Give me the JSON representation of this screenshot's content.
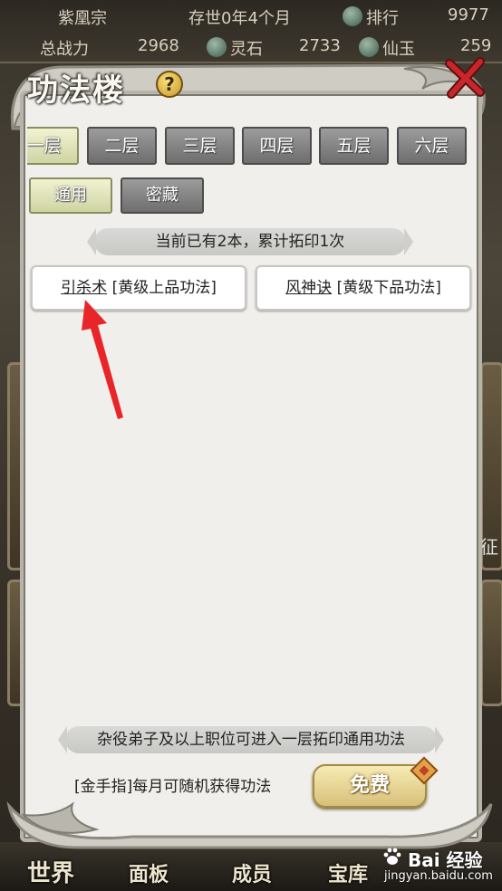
{
  "top_bar": {
    "sect_name": "紫凰宗",
    "era": "存世0年4个月",
    "rank_label": "排行",
    "rank_value": "9977",
    "power_label": "总战力",
    "power_value": "2968",
    "spirit_stone_label": "灵石",
    "spirit_stone_value": "2733",
    "jade_label": "仙玉",
    "jade_value": "259"
  },
  "dialog": {
    "title": "功法楼",
    "help_glyph": "?"
  },
  "floor_tabs": [
    {
      "label": "一层",
      "active": true
    },
    {
      "label": "二层",
      "active": false
    },
    {
      "label": "三层",
      "active": false
    },
    {
      "label": "四层",
      "active": false
    },
    {
      "label": "五层",
      "active": false
    },
    {
      "label": "六层",
      "active": false
    }
  ],
  "category_tabs": [
    {
      "label": "通用",
      "active": true
    },
    {
      "label": "密藏",
      "active": false
    }
  ],
  "status_text": "当前已有2本，累计拓印1次",
  "books": [
    {
      "name": "引杀术",
      "grade": "[黄级上品功法]"
    },
    {
      "name": "风神诀",
      "grade": "[黄级下品功法]"
    }
  ],
  "requirement_text": "杂役弟子及以上职位可进入一层拓印通用功法",
  "golden_finger_text": "[金手指]每月可随机获得功法",
  "free_button_label": "免费",
  "bottom_nav": {
    "world": "世界",
    "panel": "面板",
    "members": "成员",
    "treasury": "宝库"
  },
  "watermark": {
    "brand": "Bai 经验",
    "url": "jingyan.baidu.com"
  },
  "side_glyph": "征",
  "colors": {
    "active_tab": "#cfd4a2",
    "inactive_tab": "#7d7d7d",
    "panel_bg": "#f0efeb",
    "arrow": "#e8262a",
    "close_x": "#c8262a",
    "free_button": "#e3cc86"
  }
}
